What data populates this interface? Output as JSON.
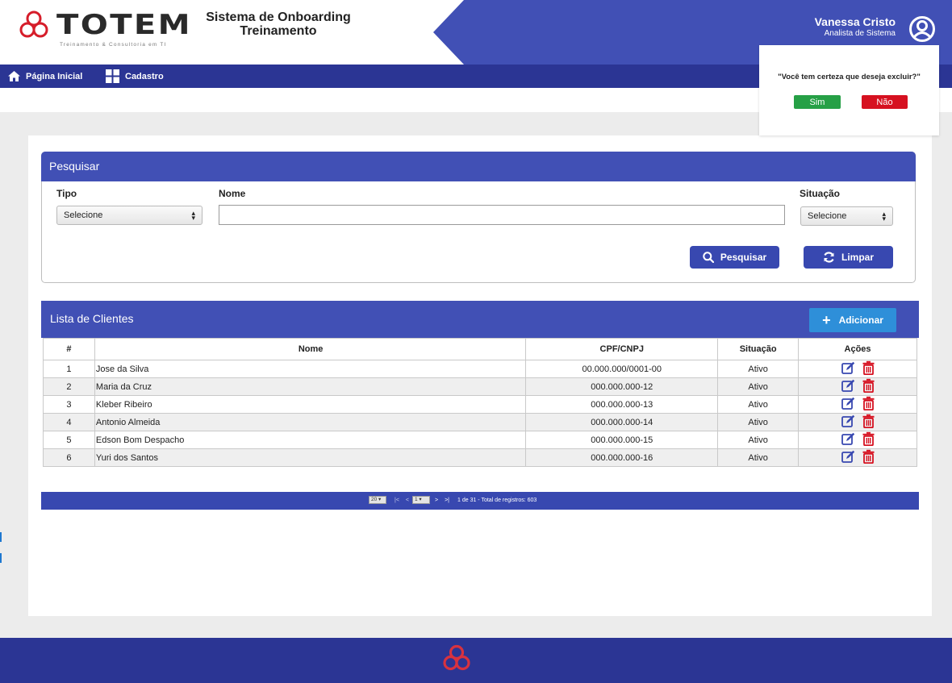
{
  "header": {
    "logo_text": "TOTEM",
    "logo_tagline": "Treinamento & Consultoria em TI",
    "system_title_line1": "Sistema de Onboarding",
    "system_title_line2": "Treinamento",
    "user_name": "Vanessa Cristo",
    "user_role": "Analista de Sistema"
  },
  "nav": {
    "home_label": "Página Inicial",
    "cadastro_label": "Cadastro"
  },
  "confirm": {
    "message": "\"Você tem certeza que deseja excluir?\"",
    "yes_label": "Sim",
    "no_label": "Não"
  },
  "search": {
    "title": "Pesquisar",
    "tipo_label": "Tipo",
    "tipo_value": "Selecione",
    "nome_label": "Nome",
    "nome_value": "",
    "situacao_label": "Situação",
    "situacao_value": "Selecione",
    "search_button": "Pesquisar",
    "clear_button": "Limpar"
  },
  "list": {
    "title": "Lista de Clientes",
    "add_button": "Adicionar",
    "columns": [
      "#",
      "Nome",
      "CPF/CNPJ",
      "Situação",
      "Ações"
    ],
    "rows": [
      {
        "num": "1",
        "nome": "Jose da Silva",
        "doc": "00.000.000/0001-00",
        "situacao": "Ativo"
      },
      {
        "num": "2",
        "nome": "Maria da Cruz",
        "doc": "000.000.000-12",
        "situacao": "Ativo"
      },
      {
        "num": "3",
        "nome": "Kleber Ribeiro",
        "doc": "000.000.000-13",
        "situacao": "Ativo"
      },
      {
        "num": "4",
        "nome": "Antonio Almeida",
        "doc": "000.000.000-14",
        "situacao": "Ativo"
      },
      {
        "num": "5",
        "nome": "Edson Bom Despacho",
        "doc": "000.000.000-15",
        "situacao": "Ativo"
      },
      {
        "num": "6",
        "nome": "Yuri dos Santos",
        "doc": "000.000.000-16",
        "situacao": "Ativo"
      }
    ],
    "pager": {
      "page_size": "20",
      "current_page": "1",
      "summary": "1 de 31 - Total de registros: 603"
    }
  },
  "colors": {
    "header_blue": "#4150b5",
    "nav_blue": "#2b3594",
    "yes_green": "#26a046",
    "no_red": "#d61120",
    "add_blue": "#2e8fd9",
    "delete_red": "#d61120"
  },
  "icons": {
    "home": "home-icon",
    "cadastro": "grid-icon",
    "search": "search-icon",
    "clear": "refresh-icon",
    "add": "plus-icon",
    "edit": "edit-icon",
    "delete": "trash-icon",
    "user": "user-avatar-icon"
  }
}
